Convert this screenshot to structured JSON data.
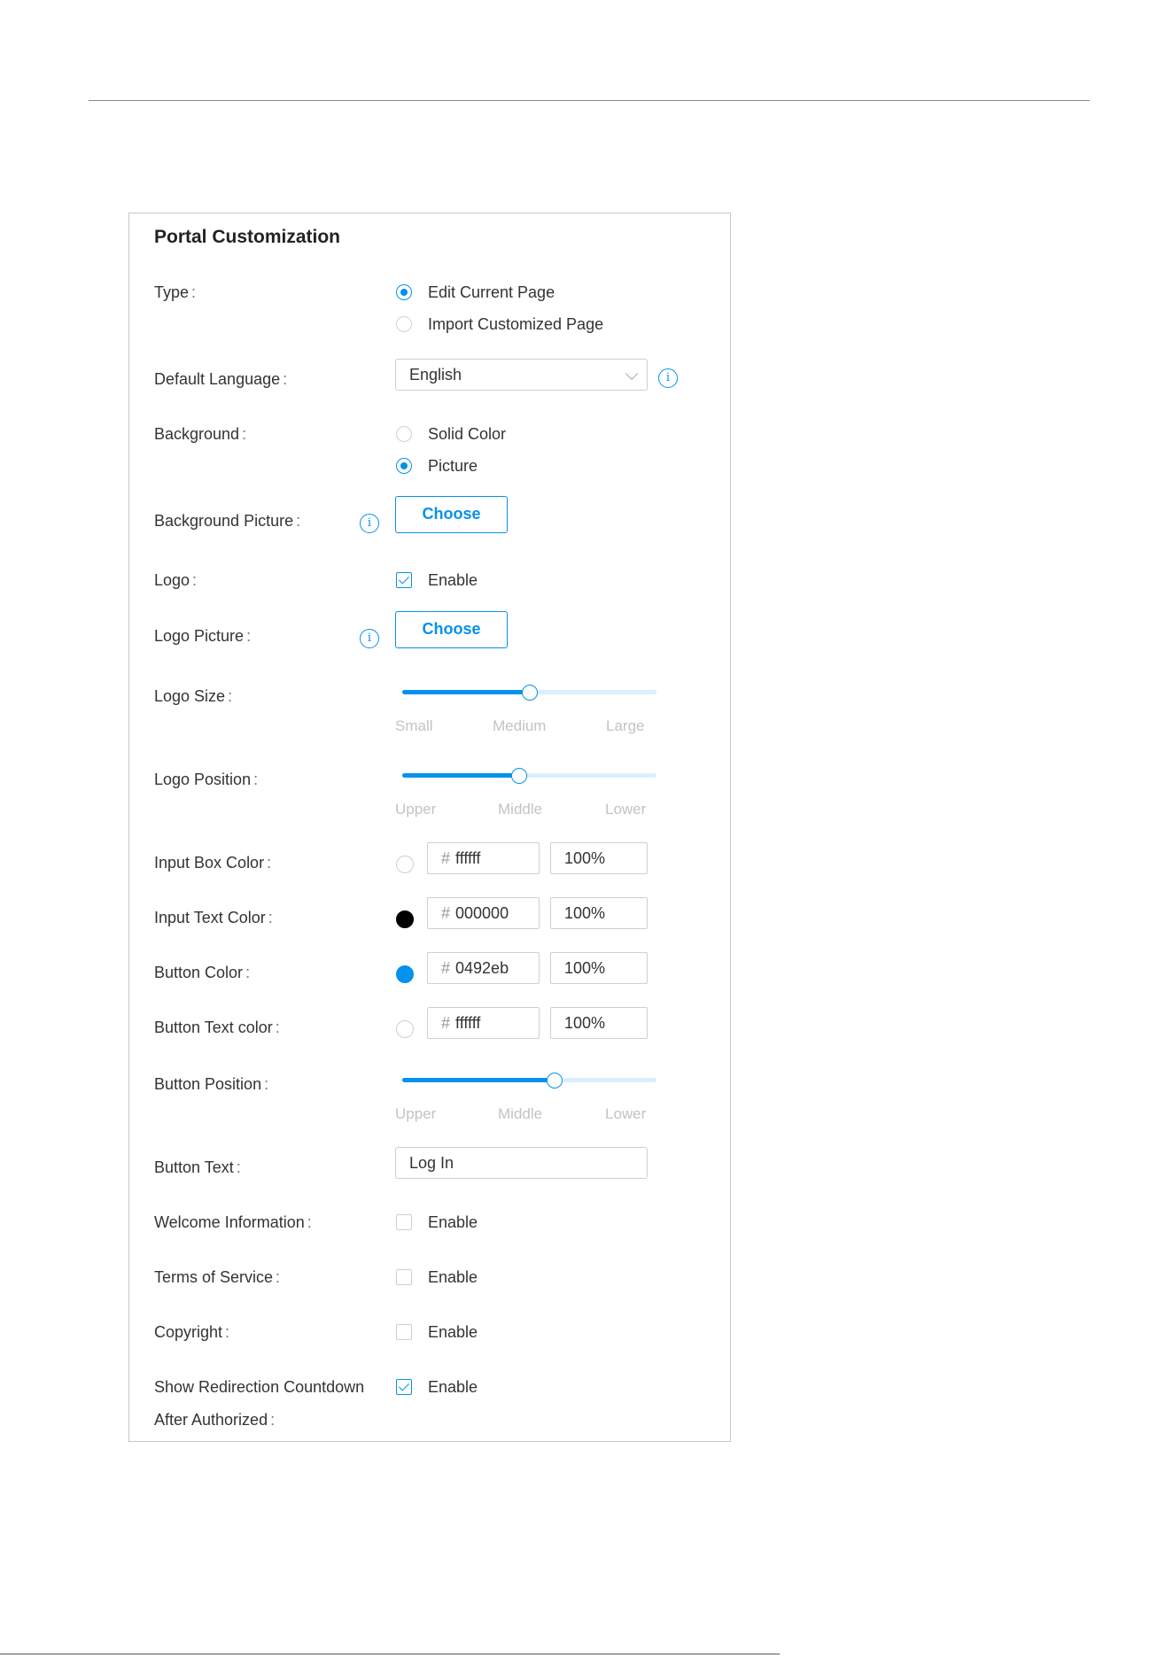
{
  "panel": {
    "title": "Portal Customization"
  },
  "colon": ":",
  "type": {
    "label": "Type",
    "options": [
      "Edit Current Page",
      "Import Customized Page"
    ],
    "selected": "Edit Current Page"
  },
  "default_language": {
    "label": "Default Language",
    "value": "English"
  },
  "background": {
    "label": "Background",
    "options": [
      "Solid Color",
      "Picture"
    ],
    "selected": "Picture"
  },
  "background_picture": {
    "label": "Background Picture",
    "button": "Choose"
  },
  "logo": {
    "label": "Logo",
    "checkbox_label": "Enable",
    "checked": true
  },
  "logo_picture": {
    "label": "Logo Picture",
    "button": "Choose"
  },
  "logo_size": {
    "label": "Logo Size",
    "ticks": [
      "Small",
      "Medium",
      "Large"
    ],
    "value": 0.5
  },
  "logo_position": {
    "label": "Logo Position",
    "ticks": [
      "Upper",
      "Middle",
      "Lower"
    ],
    "value": 0.46
  },
  "input_box_color": {
    "label": "Input Box Color",
    "hash": "#",
    "hex": "ffffff",
    "opacity": "100%",
    "swatch": "#ffffff"
  },
  "input_text_color": {
    "label": "Input Text Color",
    "hash": "#",
    "hex": "000000",
    "opacity": "100%",
    "swatch": "#000000"
  },
  "button_color": {
    "label": "Button Color",
    "hash": "#",
    "hex": "0492eb",
    "opacity": "100%",
    "swatch": "#0492eb"
  },
  "button_text_color": {
    "label": "Button Text color",
    "hash": "#",
    "hex": "ffffff",
    "opacity": "100%",
    "swatch": "#ffffff"
  },
  "button_position": {
    "label": "Button Position",
    "ticks": [
      "Upper",
      "Middle",
      "Lower"
    ],
    "value": 0.6
  },
  "button_text": {
    "label": "Button Text",
    "value": "Log In"
  },
  "welcome_information": {
    "label": "Welcome Information",
    "checkbox_label": "Enable",
    "checked": false
  },
  "terms_of_service": {
    "label": "Terms of Service",
    "checkbox_label": "Enable",
    "checked": false
  },
  "copyright": {
    "label": "Copyright",
    "checkbox_label": "Enable",
    "checked": false
  },
  "redirection_countdown": {
    "label_line1": "Show Redirection Countdown",
    "label_line2": "After Authorized",
    "checkbox_label": "Enable",
    "checked": true
  },
  "icons": {
    "info": "info-icon",
    "chevron": "chevron-down-icon"
  },
  "info_glyph": "i",
  "colors": {
    "accent": "#0492eb",
    "border": "#cfcfcf",
    "tick_label": "#c3c3c3"
  }
}
